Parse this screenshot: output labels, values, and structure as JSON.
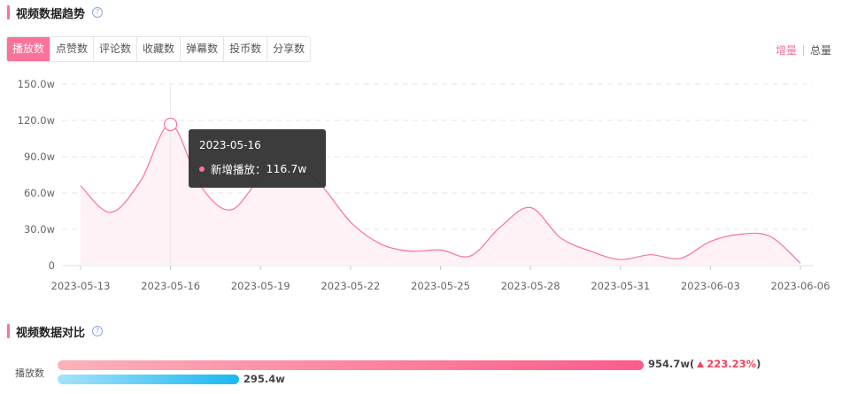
{
  "trend_section": {
    "title": "视频数据趋势",
    "help_icon": "question-circle-icon"
  },
  "tabs": [
    {
      "label": "播放数",
      "active": true
    },
    {
      "label": "点赞数",
      "active": false
    },
    {
      "label": "评论数",
      "active": false
    },
    {
      "label": "收藏数",
      "active": false
    },
    {
      "label": "弹幕数",
      "active": false
    },
    {
      "label": "投币数",
      "active": false
    },
    {
      "label": "分享数",
      "active": false
    }
  ],
  "mode_toggle": {
    "increment": "增量",
    "total": "总量",
    "active": "增量"
  },
  "colors": {
    "accent": "#fb7299",
    "compare_blue": "#1ab8f0",
    "up": "#f5435c"
  },
  "chart_data": {
    "type": "area",
    "x": [
      "2023-05-13",
      "2023-05-14",
      "2023-05-15",
      "2023-05-16",
      "2023-05-17",
      "2023-05-18",
      "2023-05-19",
      "2023-05-20",
      "2023-05-21",
      "2023-05-22",
      "2023-05-23",
      "2023-05-24",
      "2023-05-25",
      "2023-05-26",
      "2023-05-27",
      "2023-05-28",
      "2023-05-29",
      "2023-05-30",
      "2023-05-31",
      "2023-06-01",
      "2023-06-02",
      "2023-06-03",
      "2023-06-04",
      "2023-06-05",
      "2023-06-06"
    ],
    "series": [
      {
        "values": [
          66,
          44,
          70,
          116.7,
          66,
          46,
          72,
          85,
          67,
          36,
          18,
          12,
          13,
          8,
          32,
          48,
          23,
          12,
          5,
          9,
          6,
          20,
          26,
          24,
          2
        ]
      }
    ],
    "x_ticks": [
      "2023-05-13",
      "2023-05-16",
      "2023-05-19",
      "2023-05-22",
      "2023-05-25",
      "2023-05-28",
      "2023-05-31",
      "2023-06-03",
      "2023-06-06"
    ],
    "y_ticks": [
      "0",
      "30.0w",
      "60.0w",
      "90.0w",
      "120.0w",
      "150.0w"
    ],
    "ylim": [
      0,
      150
    ],
    "unit": "w",
    "grid": true,
    "tooltip": {
      "date": "2023-05-16",
      "label": "新增播放：",
      "value": "116.7w"
    }
  },
  "compare_section": {
    "title": "视频数据对比",
    "help_icon": "question-circle-icon"
  },
  "comparison": {
    "label": "播放数",
    "current_value": 954.7,
    "current_text": "954.7w(",
    "change_text": "223.23%",
    "close_paren": ")",
    "baseline_value": 295.4,
    "baseline_text": "295.4w"
  }
}
